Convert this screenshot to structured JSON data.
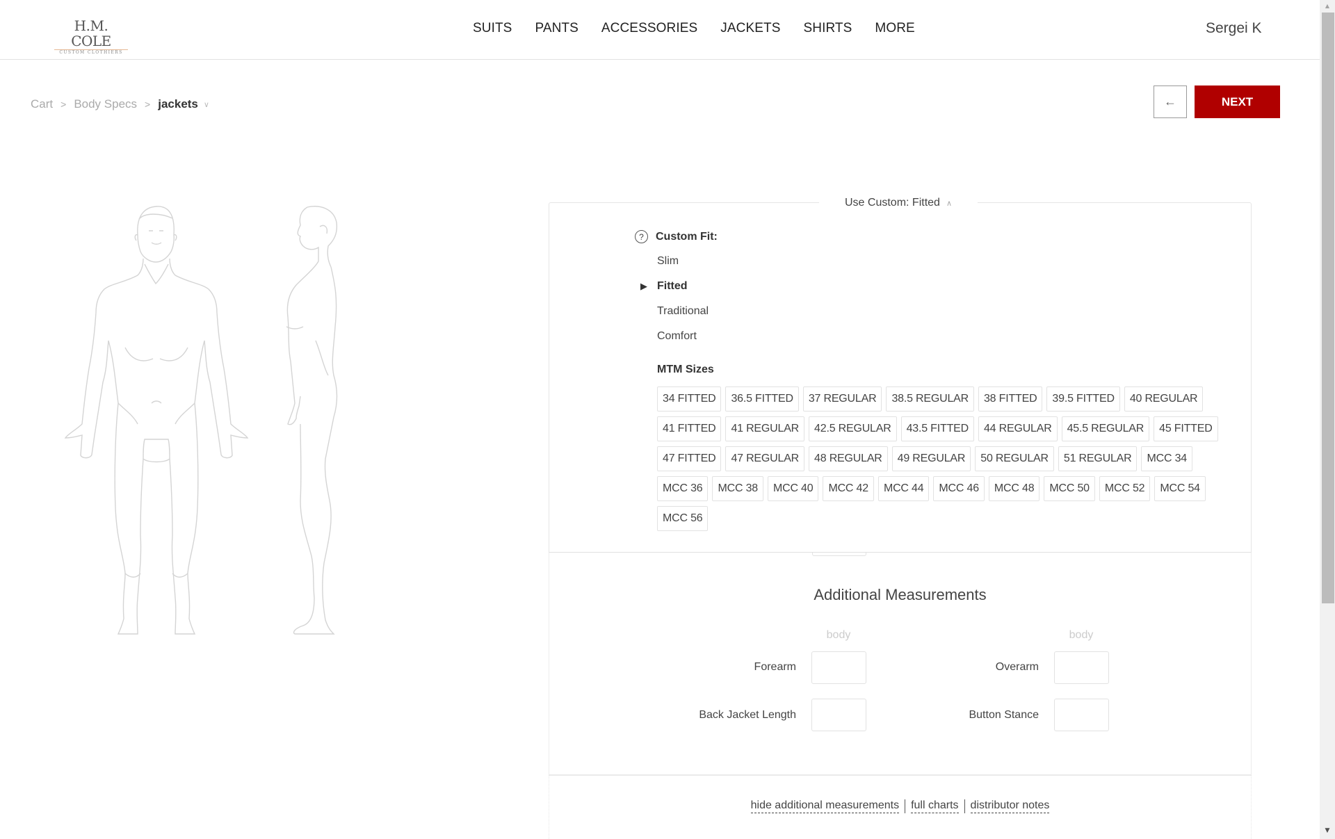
{
  "header": {
    "logo_main": "H.M. COLE",
    "logo_sub": "CUSTOM CLOTHIERS",
    "nav": [
      "SUITS",
      "PANTS",
      "ACCESSORIES",
      "JACKETS",
      "SHIRTS",
      "MORE"
    ],
    "user_name": "Sergei K"
  },
  "breadcrumb": {
    "items": [
      "Cart",
      "Body Specs"
    ],
    "current": "jackets",
    "separator": ">",
    "dropdown_icon": "chevron-down-icon"
  },
  "actions": {
    "back_label": "←",
    "next_label": "NEXT",
    "next_color": "#b00000"
  },
  "fit_panel": {
    "legend": "Use Custom: Fitted",
    "legend_icon": "chevron-up-icon",
    "heading": "Custom Fit:",
    "help_icon": "?",
    "selected_marker": "▶",
    "options": [
      "Slim",
      "Fitted",
      "Traditional",
      "Comfort"
    ],
    "selected": "Fitted",
    "mtm_label": "MTM Sizes",
    "sizes": [
      "34 FITTED",
      "36.5 FITTED",
      "37 REGULAR",
      "38.5 REGULAR",
      "38 FITTED",
      "39.5 FITTED",
      "40 REGULAR",
      "41 FITTED",
      "41 REGULAR",
      "42.5 REGULAR",
      "43.5 FITTED",
      "44 REGULAR",
      "45.5 REGULAR",
      "45 FITTED",
      "47 FITTED",
      "47 REGULAR",
      "48 REGULAR",
      "49 REGULAR",
      "50 REGULAR",
      "51 REGULAR",
      "MCC 34",
      "MCC 36",
      "MCC 38",
      "MCC 40",
      "MCC 42",
      "MCC 44",
      "MCC 46",
      "MCC 48",
      "MCC 50",
      "MCC 52",
      "MCC 54",
      "MCC 56"
    ]
  },
  "additional": {
    "title": "Additional Measurements",
    "column_head": "body",
    "fields": [
      {
        "label": "Forearm",
        "value": ""
      },
      {
        "label": "Overarm",
        "value": ""
      },
      {
        "label": "Back Jacket Length",
        "value": ""
      },
      {
        "label": "Button Stance",
        "value": ""
      }
    ]
  },
  "links": {
    "hide": "hide additional measurements",
    "charts": "full charts",
    "notes": "distributor notes"
  },
  "scrollbar": {
    "up_icon": "▲",
    "down_icon": "▼"
  }
}
